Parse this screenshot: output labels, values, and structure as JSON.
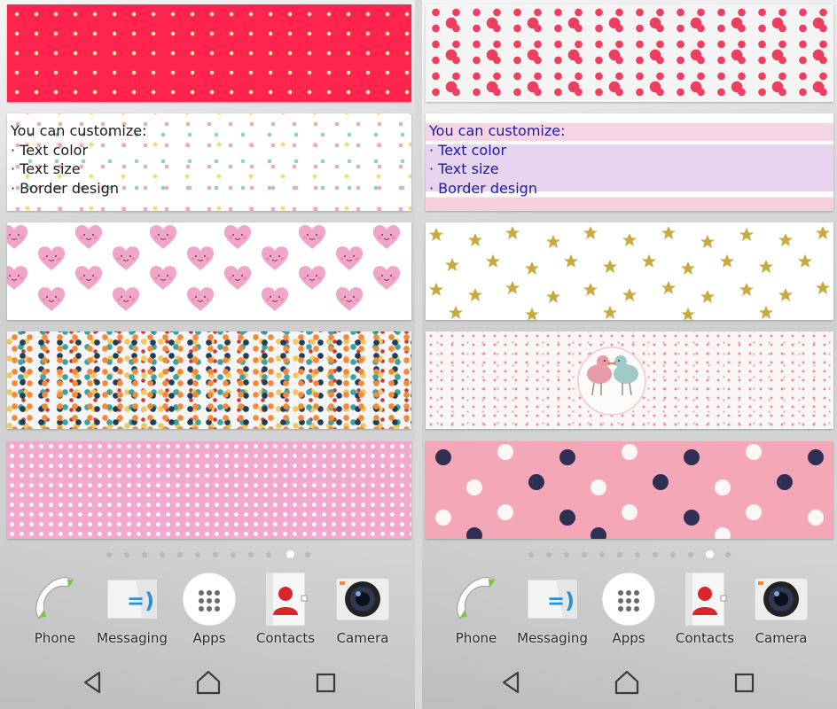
{
  "screens": [
    {
      "id": "left",
      "customize": {
        "heading": "You can customize:",
        "items": [
          "· Text color",
          "· Text size",
          "· Border design"
        ]
      },
      "page_indicator": {
        "count": 12,
        "active": 10
      },
      "dock": [
        {
          "label": "Phone",
          "icon": "phone-icon"
        },
        {
          "label": "Messaging",
          "icon": "messaging-icon"
        },
        {
          "label": "Apps",
          "icon": "apps-grid-icon"
        },
        {
          "label": "Contacts",
          "icon": "contacts-icon"
        },
        {
          "label": "Camera",
          "icon": "camera-icon"
        }
      ]
    },
    {
      "id": "right",
      "customize": {
        "heading": "You can customize:",
        "items": [
          "· Text color",
          "· Text size",
          "· Border design"
        ]
      },
      "page_indicator": {
        "count": 12,
        "active": 10
      },
      "dock": [
        {
          "label": "Phone",
          "icon": "phone-icon"
        },
        {
          "label": "Messaging",
          "icon": "messaging-icon"
        },
        {
          "label": "Apps",
          "icon": "apps-grid-icon"
        },
        {
          "label": "Contacts",
          "icon": "contacts-icon"
        },
        {
          "label": "Camera",
          "icon": "camera-icon"
        }
      ]
    }
  ],
  "colors": {
    "left_text": "#1a1a1a",
    "right_text": "#1a1aa8",
    "red_strip": "#ff2450",
    "pink_strip": "#f3a9cf"
  },
  "navbar": {
    "back_icon": "back-triangle-icon",
    "home_icon": "home-icon",
    "recents_icon": "recents-square-icon"
  }
}
